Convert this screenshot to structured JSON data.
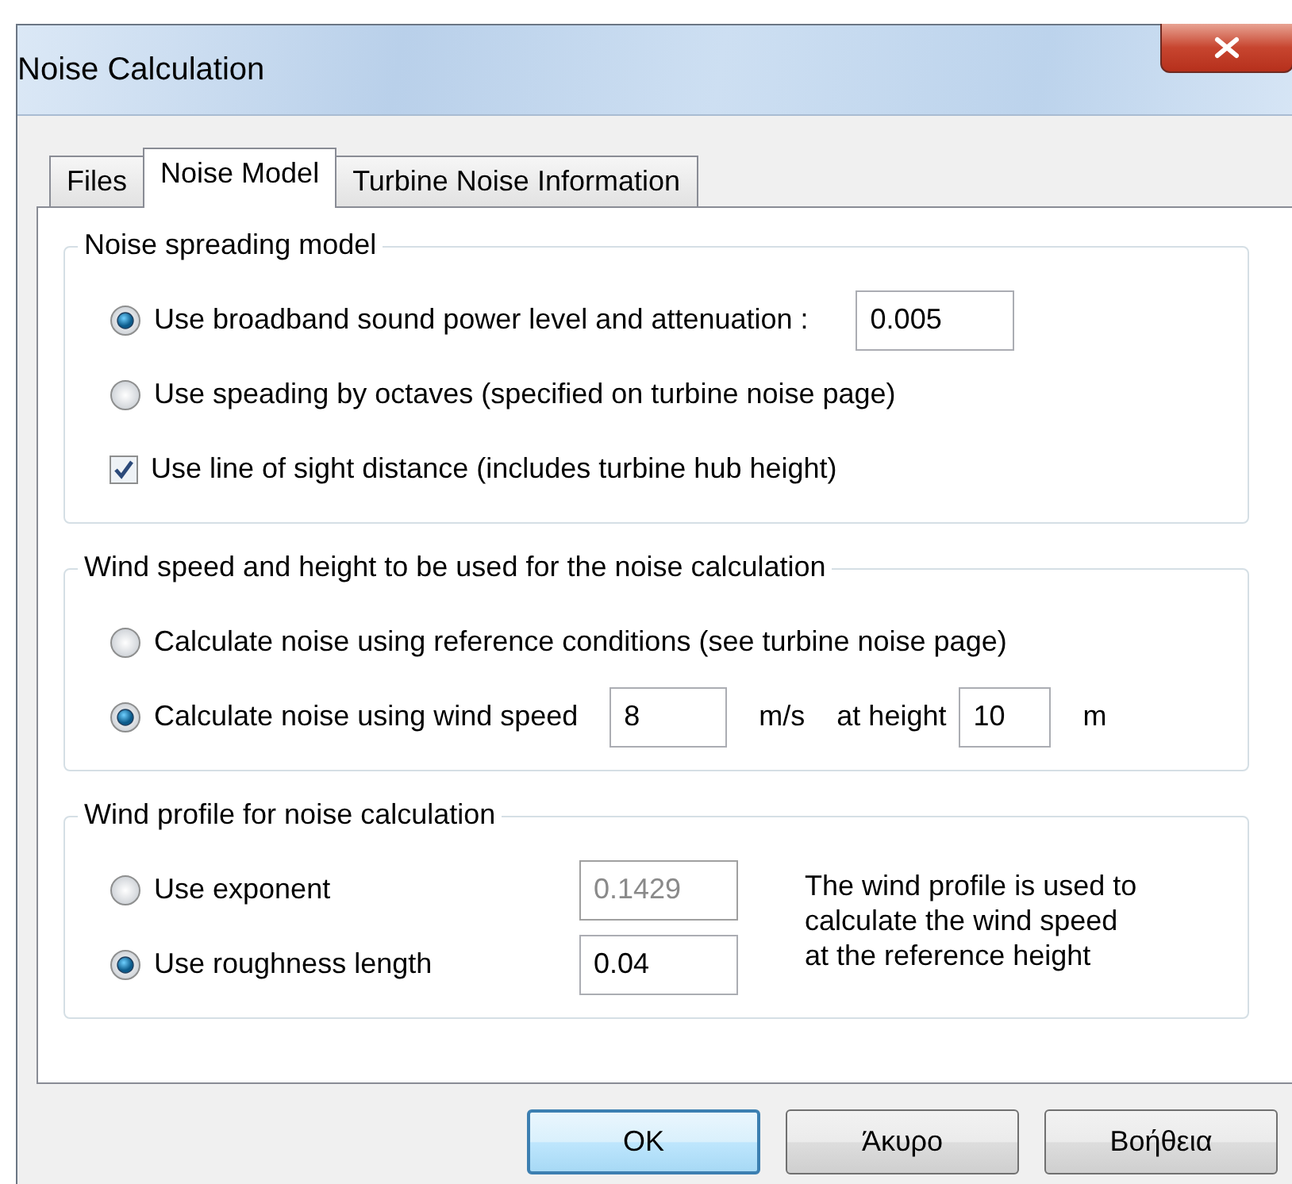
{
  "window": {
    "title": "Noise Calculation"
  },
  "tabs": [
    {
      "label": "Files",
      "selected": false
    },
    {
      "label": "Noise Model",
      "selected": true
    },
    {
      "label": "Turbine Noise Information",
      "selected": false
    }
  ],
  "groups": [
    {
      "title": "Noise spreading model",
      "rows": [
        {
          "kind": "radio",
          "label": "Use broadband sound power level and attenuation :",
          "selected": true,
          "parts": [
            {
              "kind": "field",
              "value": "0.005",
              "disabled": false
            }
          ]
        },
        {
          "kind": "radio",
          "label": "Use speading by octaves (specified on turbine noise page)",
          "selected": false
        },
        {
          "kind": "checkbox",
          "label": "Use line of sight distance (includes turbine hub height)",
          "checked": true
        }
      ]
    },
    {
      "title": "Wind speed and height to be used for the noise calculation",
      "rows": [
        {
          "kind": "radio",
          "label": "Calculate noise using reference conditions (see turbine noise page)",
          "selected": false
        },
        {
          "kind": "radio",
          "label": "Calculate noise using wind speed",
          "selected": true,
          "parts": [
            {
              "kind": "field",
              "value": "8",
              "disabled": false
            },
            {
              "kind": "text",
              "text": "m/s"
            },
            {
              "kind": "text",
              "text": "at height"
            },
            {
              "kind": "field",
              "value": "10",
              "disabled": false
            },
            {
              "kind": "text",
              "text": "m"
            }
          ]
        }
      ]
    },
    {
      "title": "Wind profile for noise calculation",
      "note": "The wind profile is used to\ncalculate the wind speed\nat the reference height",
      "rows": [
        {
          "kind": "radio",
          "label": "Use exponent",
          "selected": false,
          "parts": [
            {
              "kind": "field",
              "value": "0.1429",
              "disabled": true
            }
          ]
        },
        {
          "kind": "radio",
          "label": "Use roughness length",
          "selected": true,
          "parts": [
            {
              "kind": "field",
              "value": "0.04",
              "disabled": false
            }
          ]
        }
      ]
    }
  ],
  "buttons": [
    {
      "label": "OK",
      "default": true
    },
    {
      "label": "Άκυρο",
      "default": false
    },
    {
      "label": "Βοήθεια",
      "default": false
    }
  ]
}
